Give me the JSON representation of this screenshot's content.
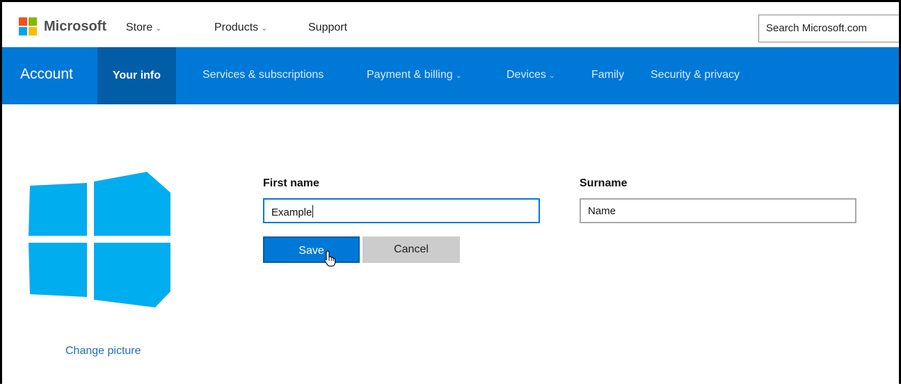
{
  "header": {
    "brand": "Microsoft",
    "nav": [
      {
        "label": "Store",
        "chevron": "⌄"
      },
      {
        "label": "Products",
        "chevron": "⌄"
      },
      {
        "label": "Support"
      }
    ],
    "search_placeholder": "Search Microsoft.com"
  },
  "account_nav": {
    "title": "Account",
    "tabs": [
      {
        "label": "Your info",
        "active": true
      },
      {
        "label": "Services & subscriptions"
      },
      {
        "label": "Payment & billing",
        "chevron": "⌄"
      },
      {
        "label": "Devices",
        "chevron": "⌄"
      },
      {
        "label": "Family"
      },
      {
        "label": "Security & privacy"
      }
    ]
  },
  "profile": {
    "change_picture": "Change picture",
    "avatar_icon": "windows-logo-icon",
    "avatar_color": "#00adef"
  },
  "form": {
    "first_name_label": "First name",
    "first_name_value": "Example",
    "surname_label": "Surname",
    "surname_value": "Name",
    "save_label": "Save",
    "cancel_label": "Cancel"
  },
  "colors": {
    "accent": "#0078d7",
    "active_tab": "#005da6"
  }
}
